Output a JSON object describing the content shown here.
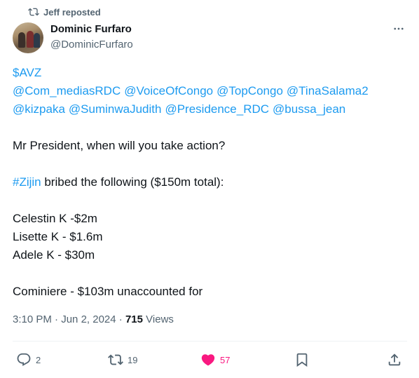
{
  "repost": {
    "text": "Jeff reposted"
  },
  "author": {
    "name": "Dominic Furfaro",
    "handle": "@DominicFurfaro"
  },
  "tweet": {
    "cashtag": "$AVZ",
    "mentions_line1": [
      "@Com_mediasRDC",
      "@VoiceOfCongo",
      "@TopCongo",
      "@TinaSalama2"
    ],
    "mentions_line2": [
      "@kizpaka",
      "@SuminwaJudith",
      "@Presidence_RDC",
      "@bussa_jean"
    ],
    "question": "Mr President, when will you take action?",
    "hashtag": "#Zijin",
    "bribe_text": " bribed the following ($150m total):",
    "bribes": [
      "Celestin K -$2m",
      "Lisette K - $1.6m",
      "Adele K - $30m"
    ],
    "unaccounted": "Cominiere - $103m unaccounted for"
  },
  "meta": {
    "time": "3:10 PM",
    "date": "Jun 2, 2024",
    "views_count": "715",
    "views_label": "Views"
  },
  "actions": {
    "replies": "2",
    "reposts": "19",
    "likes": "57"
  },
  "colors": {
    "link": "#1d9bf0",
    "like": "#f91880",
    "secondary_text": "#536471"
  },
  "icons": [
    "repost-icon",
    "more-icon",
    "reply-icon",
    "retweet-icon",
    "heart-icon",
    "bookmark-icon",
    "share-icon"
  ]
}
